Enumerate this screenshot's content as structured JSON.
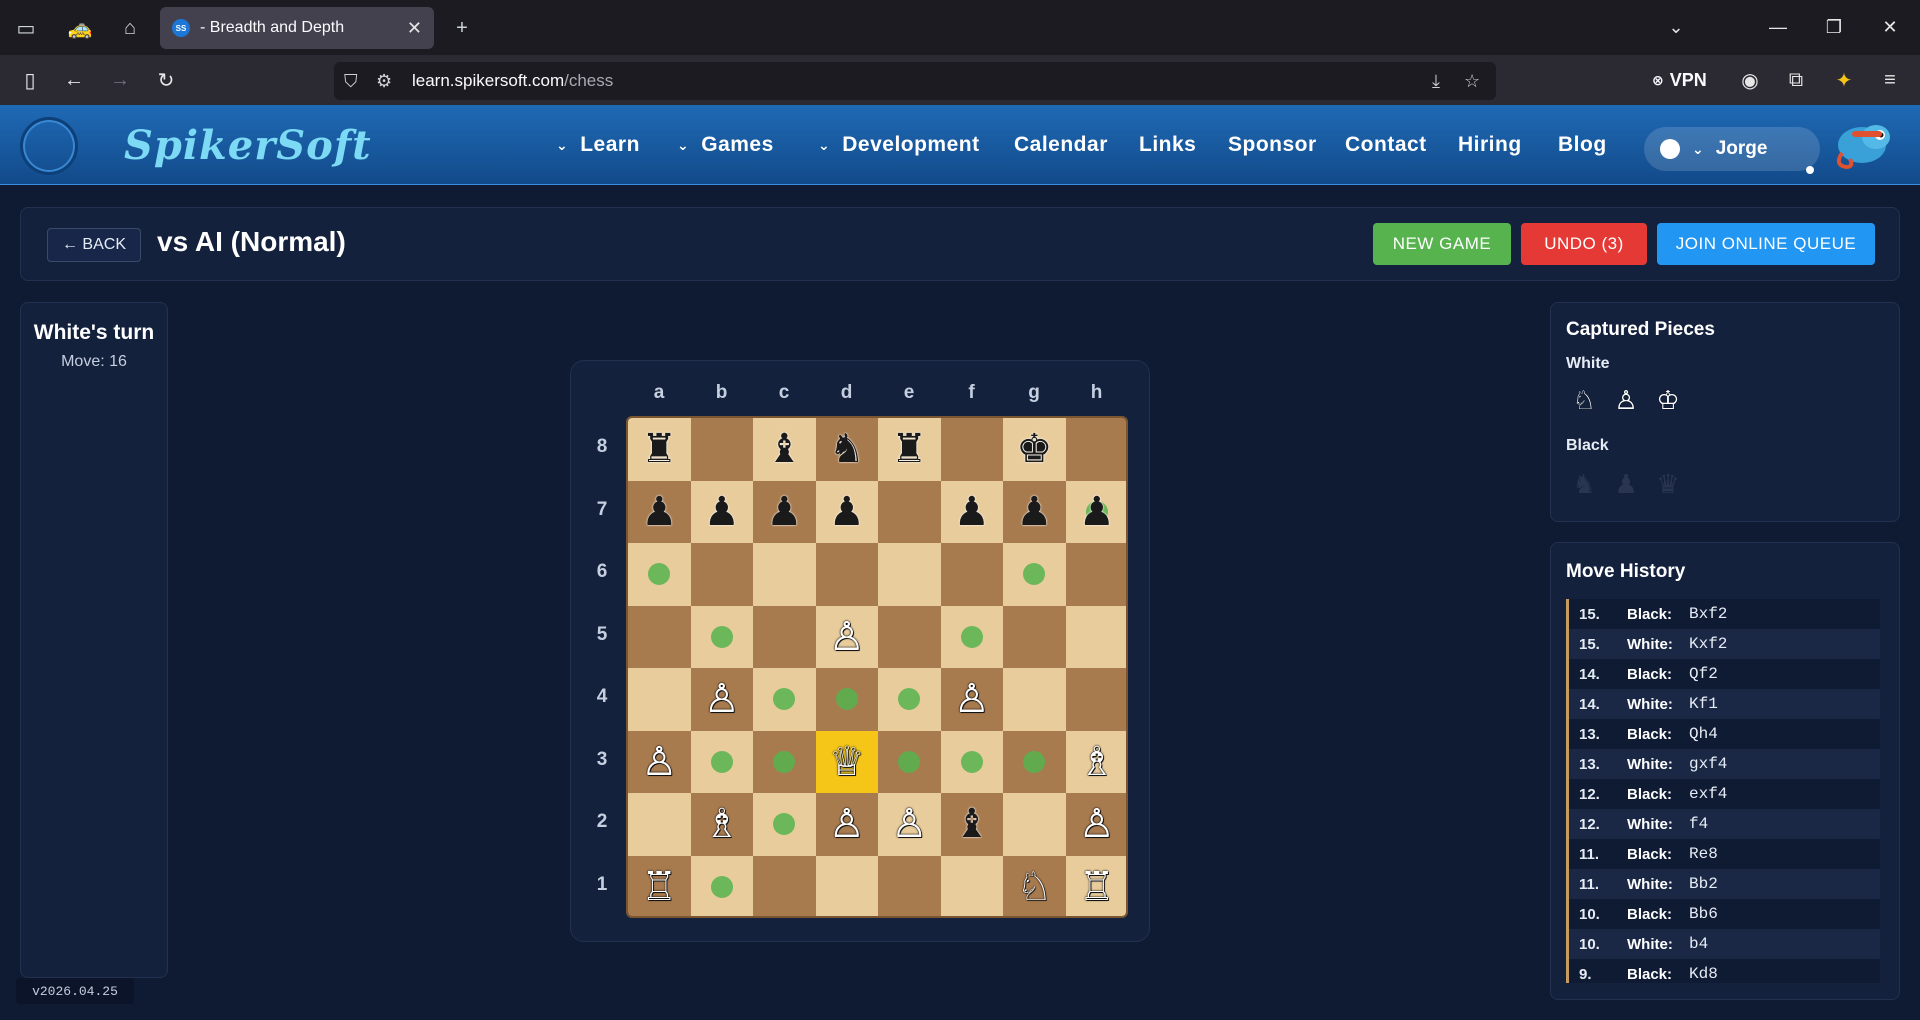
{
  "browser": {
    "tab_title": "- Breadth and Depth",
    "tab_favicon_text": "SS",
    "url_host": "learn.spikersoft.com",
    "url_path": "/chess",
    "vpn_label": "VPN"
  },
  "site": {
    "brand": "SpikerSoft",
    "menu": [
      {
        "label": "Learn",
        "dropdown": true
      },
      {
        "label": "Games",
        "dropdown": true
      },
      {
        "label": "Development",
        "dropdown": true
      },
      {
        "label": "Calendar",
        "dropdown": false
      },
      {
        "label": "Links",
        "dropdown": false
      },
      {
        "label": "Sponsor",
        "dropdown": false
      },
      {
        "label": "Contact",
        "dropdown": false
      },
      {
        "label": "Hiring",
        "dropdown": false
      },
      {
        "label": "Blog",
        "dropdown": false
      }
    ],
    "user_name": "Jorge"
  },
  "toolbar": {
    "back_label": "← BACK",
    "title": "vs AI (Normal)",
    "new_game_label": "NEW GAME",
    "undo_label": "UNDO (3)",
    "join_label": "JOIN ONLINE QUEUE"
  },
  "status": {
    "turn": "White's turn",
    "move": "Move: 16"
  },
  "version": "v2026.04.25",
  "board": {
    "files": [
      "a",
      "b",
      "c",
      "d",
      "e",
      "f",
      "g",
      "h"
    ],
    "ranks": [
      "8",
      "7",
      "6",
      "5",
      "4",
      "3",
      "2",
      "1"
    ],
    "selected": "d3",
    "pieces": [
      {
        "sq": "a8",
        "color": "b",
        "type": "R"
      },
      {
        "sq": "c8",
        "color": "b",
        "type": "B"
      },
      {
        "sq": "d8",
        "color": "b",
        "type": "N"
      },
      {
        "sq": "e8",
        "color": "b",
        "type": "R"
      },
      {
        "sq": "g8",
        "color": "b",
        "type": "K"
      },
      {
        "sq": "a7",
        "color": "b",
        "type": "P"
      },
      {
        "sq": "b7",
        "color": "b",
        "type": "P"
      },
      {
        "sq": "c7",
        "color": "b",
        "type": "P"
      },
      {
        "sq": "d7",
        "color": "b",
        "type": "P"
      },
      {
        "sq": "f7",
        "color": "b",
        "type": "P"
      },
      {
        "sq": "g7",
        "color": "b",
        "type": "P"
      },
      {
        "sq": "h7",
        "color": "b",
        "type": "P"
      },
      {
        "sq": "d5",
        "color": "w",
        "type": "P"
      },
      {
        "sq": "b4",
        "color": "w",
        "type": "P"
      },
      {
        "sq": "f4",
        "color": "w",
        "type": "P"
      },
      {
        "sq": "a3",
        "color": "w",
        "type": "P"
      },
      {
        "sq": "d3",
        "color": "w",
        "type": "Q"
      },
      {
        "sq": "h3",
        "color": "w",
        "type": "B"
      },
      {
        "sq": "b2",
        "color": "w",
        "type": "B"
      },
      {
        "sq": "d2",
        "color": "w",
        "type": "P"
      },
      {
        "sq": "e2",
        "color": "w",
        "type": "P"
      },
      {
        "sq": "f2",
        "color": "b",
        "type": "B"
      },
      {
        "sq": "h2",
        "color": "w",
        "type": "P"
      },
      {
        "sq": "a1",
        "color": "w",
        "type": "R"
      },
      {
        "sq": "g1",
        "color": "w",
        "type": "N"
      },
      {
        "sq": "h1",
        "color": "w",
        "type": "R"
      }
    ],
    "hints": [
      "h7",
      "a6",
      "g6",
      "b5",
      "f5",
      "c4",
      "d4",
      "e4",
      "b3",
      "c3",
      "e3",
      "f3",
      "g3",
      "c2",
      "b1"
    ]
  },
  "captured": {
    "title": "Captured Pieces",
    "white_label": "White",
    "black_label": "Black",
    "white": [
      "N",
      "P",
      "K"
    ],
    "black": [
      "N",
      "P",
      "Q"
    ]
  },
  "history": {
    "title": "Move History",
    "moves": [
      {
        "num": "15.",
        "side": "Black:",
        "move": "Bxf2"
      },
      {
        "num": "15.",
        "side": "White:",
        "move": "Kxf2"
      },
      {
        "num": "14.",
        "side": "Black:",
        "move": "Qf2"
      },
      {
        "num": "14.",
        "side": "White:",
        "move": "Kf1"
      },
      {
        "num": "13.",
        "side": "Black:",
        "move": "Qh4"
      },
      {
        "num": "13.",
        "side": "White:",
        "move": "gxf4"
      },
      {
        "num": "12.",
        "side": "Black:",
        "move": "exf4"
      },
      {
        "num": "12.",
        "side": "White:",
        "move": "f4"
      },
      {
        "num": "11.",
        "side": "Black:",
        "move": "Re8"
      },
      {
        "num": "11.",
        "side": "White:",
        "move": "Bb2"
      },
      {
        "num": "10.",
        "side": "Black:",
        "move": "Bb6"
      },
      {
        "num": "10.",
        "side": "White:",
        "move": "b4"
      },
      {
        "num": "9.",
        "side": "Black:",
        "move": "Kd8"
      }
    ]
  },
  "colors": {
    "light_square": "#e8cc9c",
    "dark_square": "#a87b4f",
    "selected_square": "#f5c518",
    "hint": "#56b34e",
    "green_button": "#56b34e",
    "red_button": "#e53935",
    "blue_button": "#2196f3"
  }
}
